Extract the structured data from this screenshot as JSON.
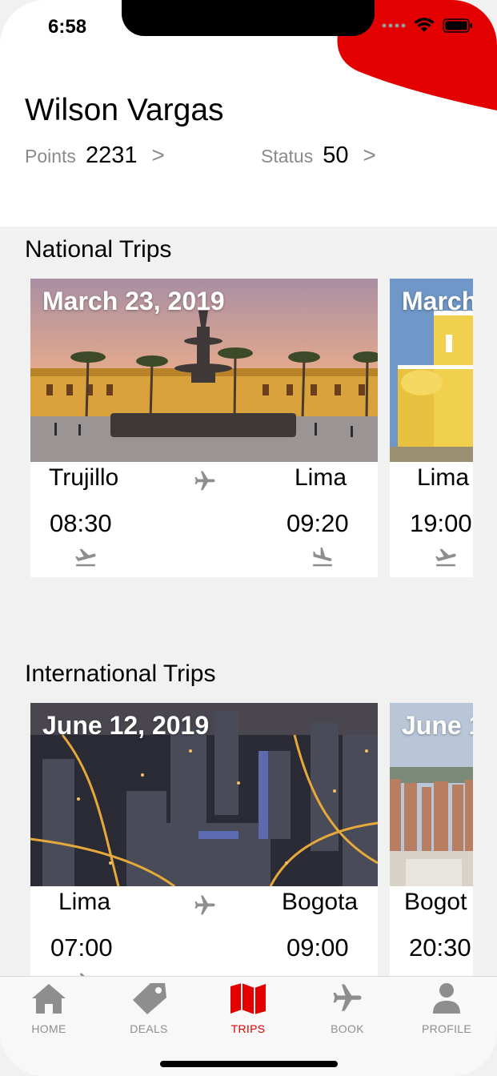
{
  "status_bar": {
    "time": "6:58"
  },
  "profile": {
    "name": "Wilson Vargas",
    "points_label": "Points",
    "points_value": "2231",
    "status_label": "Status",
    "status_value": "50",
    "arrow": ">"
  },
  "national": {
    "title": "National Trips",
    "trips": [
      {
        "date": "March 23, 2019",
        "from": "Trujillo",
        "to": "Lima",
        "depart": "08:30",
        "arrive": "09:20"
      },
      {
        "date": "March",
        "from": "Lima",
        "depart": "19:00"
      }
    ]
  },
  "international": {
    "title": "International Trips",
    "trips": [
      {
        "date": "June 12, 2019",
        "from": "Lima",
        "to": "Bogota",
        "depart": "07:00",
        "arrive": "09:00"
      },
      {
        "date": "June 1",
        "from": "Bogot",
        "depart": "20:30"
      }
    ]
  },
  "tabs": [
    {
      "label": "HOME",
      "icon": "home-icon"
    },
    {
      "label": "DEALS",
      "icon": "tag-icon"
    },
    {
      "label": "TRIPS",
      "icon": "map-icon",
      "active": true
    },
    {
      "label": "BOOK",
      "icon": "airplane-icon"
    },
    {
      "label": "PROFILE",
      "icon": "person-icon"
    }
  ],
  "colors": {
    "accent": "#e30000",
    "muted": "#8e8e8e",
    "background": "#f1f1f1"
  }
}
